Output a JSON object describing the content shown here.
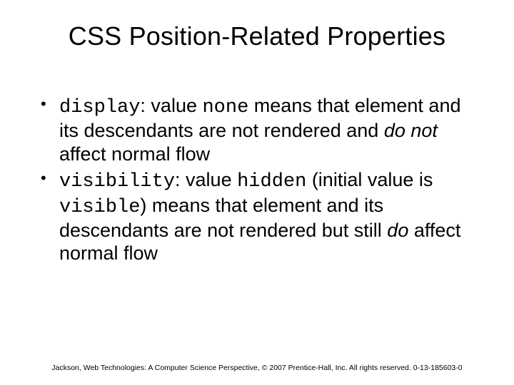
{
  "title": "CSS Position-Related Properties",
  "bullets": [
    {
      "parts": {
        "code1": "display",
        "t1": ": value ",
        "code2": "none",
        "t2": " means that element and its descendants are not rendered and ",
        "ital": "do not",
        "t3": " affect normal flow"
      }
    },
    {
      "parts": {
        "code1": "visibility",
        "t1": ": value ",
        "code2": "hidden",
        "t2": " (initial value is ",
        "code3": "visible",
        "t3": ") means that element and its descendants are not rendered but still ",
        "ital": "do",
        "t4": " affect normal flow"
      }
    }
  ],
  "footer": "Jackson, Web Technologies: A Computer Science Perspective, © 2007 Prentice-Hall, Inc. All rights reserved. 0-13-185603-0",
  "bullet_glyph": "•"
}
